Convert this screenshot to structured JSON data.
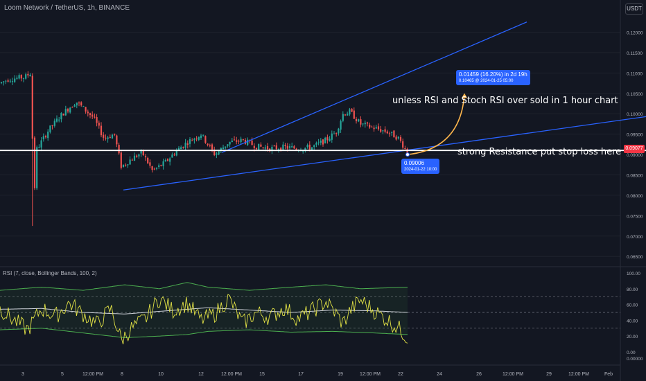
{
  "header": {
    "symbol_line": "Loom Network / TetherUS, 1h, BINANCE",
    "currency_button": "USDT"
  },
  "rsi_header": {
    "label": "RSI (7, close, Bollinger Bands, 100, 2)"
  },
  "annotations": {
    "target_label_main": "0.01459 (16.20%) in 2d 19h",
    "target_label_sub": "0.10465 @ 2024-01-25 05:00",
    "entry_label_main": "0.09006",
    "entry_label_sub": "2024-01-22 10:00",
    "note_rsi": "unless RSI and Stoch RSI over sold in 1 hour chart",
    "note_resistance": "strong Resistance put stop loss here",
    "last_price": "0.09077"
  },
  "colors": {
    "background": "#131722",
    "up": "#26a69a",
    "down": "#ef5350",
    "trendline": "#2962ff",
    "horizontal": "#ffffff",
    "rsi": "#e2e246",
    "bands": "#4caf50",
    "basis": "#d1d4dc",
    "arrow": "#ffb74d"
  },
  "chart_data": [
    {
      "type": "candlestick",
      "title": "Loom Network / TetherUS, 1h, BINANCE",
      "y_ticks": [
        "0.12000",
        "0.11500",
        "0.11000",
        "0.10500",
        "0.10000",
        "0.09500",
        "0.09000",
        "0.08500",
        "0.08000",
        "0.07500",
        "0.07000",
        "0.06500"
      ],
      "x_ticks": [
        "3",
        "5",
        "12:00 PM",
        "8",
        "10",
        "12",
        "12:00 PM",
        "15",
        "17",
        "19",
        "12:00 PM",
        "22",
        "24",
        "26",
        "12:00 PM",
        "29",
        "12:00 PM",
        "Feb"
      ],
      "ylim": [
        0.063,
        0.1245
      ],
      "xlim": [
        0,
        780
      ],
      "anchors": [
        [
          0,
          0.1075
        ],
        [
          12,
          0.1085
        ],
        [
          36,
          0.109
        ],
        [
          44,
          0.11
        ],
        [
          46,
          0.108
        ],
        [
          48,
          0.073
        ],
        [
          52,
          0.091
        ],
        [
          70,
          0.096
        ],
        [
          90,
          0.1
        ],
        [
          110,
          0.103
        ],
        [
          135,
          0.099
        ],
        [
          150,
          0.094
        ],
        [
          165,
          0.095
        ],
        [
          175,
          0.087
        ],
        [
          190,
          0.089
        ],
        [
          205,
          0.0905
        ],
        [
          220,
          0.086
        ],
        [
          238,
          0.088
        ],
        [
          255,
          0.091
        ],
        [
          270,
          0.093
        ],
        [
          290,
          0.095
        ],
        [
          310,
          0.09
        ],
        [
          330,
          0.093
        ],
        [
          350,
          0.0935
        ],
        [
          370,
          0.092
        ],
        [
          390,
          0.0915
        ],
        [
          410,
          0.0918
        ],
        [
          430,
          0.0915
        ],
        [
          450,
          0.0918
        ],
        [
          470,
          0.0935
        ],
        [
          485,
          0.0955
        ],
        [
          495,
          0.1
        ],
        [
          505,
          0.1005
        ],
        [
          520,
          0.0975
        ],
        [
          540,
          0.0965
        ],
        [
          560,
          0.0955
        ],
        [
          575,
          0.094
        ],
        [
          588,
          0.0905
        ]
      ],
      "trendlines": [
        {
          "name": "upper-channel",
          "from": [
            320,
            0.0905
          ],
          "to": [
            760,
            0.1225
          ]
        },
        {
          "name": "lower-channel",
          "from": [
            178,
            0.0813
          ],
          "to": [
            932,
            0.0993
          ]
        },
        {
          "name": "horizontal-resistance",
          "from": [
            0,
            0.091
          ],
          "to": [
            932,
            0.091
          ]
        }
      ],
      "projection": {
        "from": [
          588,
          0.09
        ],
        "to": [
          670,
          0.1047
        ]
      }
    },
    {
      "type": "line",
      "title": "RSI (7, close, Bollinger Bands, 100, 2)",
      "y_ticks": [
        "100.00",
        "80.00",
        "60.00",
        "40.00",
        "20.00",
        "0.00",
        "0.00000"
      ],
      "ylim": [
        0,
        100
      ],
      "levels": [
        70,
        50,
        30
      ],
      "series": [
        {
          "name": "RSI",
          "anchors": [
            [
              0,
              55
            ],
            [
              20,
              40
            ],
            [
              40,
              28
            ],
            [
              60,
              55
            ],
            [
              80,
              45
            ],
            [
              100,
              62
            ],
            [
              120,
              48
            ],
            [
              140,
              35
            ],
            [
              160,
              55
            ],
            [
              175,
              15
            ],
            [
              190,
              30
            ],
            [
              210,
              42
            ],
            [
              230,
              68
            ],
            [
              250,
              52
            ],
            [
              270,
              62
            ],
            [
              290,
              40
            ],
            [
              310,
              48
            ],
            [
              330,
              68
            ],
            [
              350,
              36
            ],
            [
              370,
              50
            ],
            [
              390,
              44
            ],
            [
              410,
              56
            ],
            [
              430,
              42
            ],
            [
              450,
              52
            ],
            [
              470,
              64
            ],
            [
              485,
              48
            ],
            [
              495,
              36
            ],
            [
              505,
              52
            ],
            [
              520,
              66
            ],
            [
              540,
              52
            ],
            [
              560,
              40
            ],
            [
              575,
              30
            ],
            [
              588,
              18
            ]
          ]
        },
        {
          "name": "Upper Band",
          "anchors": [
            [
              0,
              78
            ],
            [
              60,
              82
            ],
            [
              120,
              78
            ],
            [
              180,
              85
            ],
            [
              230,
              80
            ],
            [
              270,
              88
            ],
            [
              300,
              82
            ],
            [
              360,
              78
            ],
            [
              420,
              82
            ],
            [
              470,
              85
            ],
            [
              520,
              80
            ],
            [
              588,
              82
            ]
          ]
        },
        {
          "name": "Basis",
          "anchors": [
            [
              0,
              54
            ],
            [
              60,
              55
            ],
            [
              120,
              50
            ],
            [
              180,
              48
            ],
            [
              240,
              52
            ],
            [
              300,
              56
            ],
            [
              360,
              53
            ],
            [
              420,
              50
            ],
            [
              480,
              53
            ],
            [
              540,
              52
            ],
            [
              588,
              50
            ]
          ]
        },
        {
          "name": "Lower Band",
          "anchors": [
            [
              0,
              28
            ],
            [
              60,
              30
            ],
            [
              120,
              24
            ],
            [
              180,
              18
            ],
            [
              230,
              20
            ],
            [
              270,
              22
            ],
            [
              300,
              26
            ],
            [
              360,
              28
            ],
            [
              420,
              25
            ],
            [
              480,
              26
            ],
            [
              540,
              24
            ],
            [
              588,
              22
            ]
          ]
        }
      ]
    }
  ]
}
